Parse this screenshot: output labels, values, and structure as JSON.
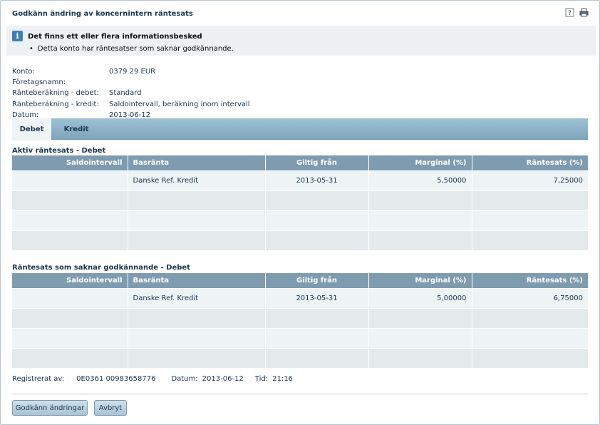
{
  "page": {
    "title": "Godkänn ändring av koncernintern räntesats",
    "icons": [
      "help-icon",
      "print-icon"
    ]
  },
  "info": {
    "title": "Det finns ett eller flera informationsbesked",
    "message": "Detta konto har räntesatser som saknar godkännande."
  },
  "details": [
    {
      "label": "Konto:",
      "value": "0379 29 EUR"
    },
    {
      "label": "Företagsnamn:",
      "value": ""
    },
    {
      "label": "Ränteberäkning - debet:",
      "value": "Standard"
    },
    {
      "label": "Ränteberäkning - kredit:",
      "value": "Saldointervall, beräkning inom intervall"
    },
    {
      "label": "Datum:",
      "value": "2013-06-12"
    }
  ],
  "tabs": [
    {
      "label": "Debet",
      "active": true
    },
    {
      "label": "Kredit",
      "active": false
    }
  ],
  "columns": [
    "Saldointervall",
    "Basränta",
    "Giltig från",
    "Marginal (%)",
    "Räntesats (%)"
  ],
  "active_table": {
    "title": "Aktiv räntesats - Debet",
    "rows": [
      [
        "",
        "Danske Ref. Kredit",
        "2013-05-31",
        "5,50000",
        "7,25000"
      ],
      [
        "",
        "",
        "",
        "",
        ""
      ],
      [
        "",
        "",
        "",
        "",
        ""
      ],
      [
        "",
        "",
        "",
        "",
        ""
      ]
    ]
  },
  "pending_table": {
    "title": "Räntesats som saknar godkännande - Debet",
    "rows": [
      [
        "",
        "Danske Ref. Kredit",
        "2013-05-31",
        "5,00000",
        "6,75000"
      ],
      [
        "",
        "",
        "",
        "",
        ""
      ],
      [
        "",
        "",
        "",
        "",
        ""
      ],
      [
        "",
        "",
        "",
        "",
        ""
      ]
    ]
  },
  "footer": {
    "registered_label": "Registrerat av:",
    "registered_value": "0E0361 00983658776",
    "date_label": "Datum:",
    "date_value": "2013-06-12",
    "time_label": "Tid:",
    "time_value": "21:16"
  },
  "buttons": {
    "approve": "Godkänn ändringar",
    "cancel": "Avbryt"
  },
  "colors": {
    "header": "#7f9bb0",
    "tab_bar": "#8fb3c8",
    "text": "#1b3550"
  }
}
